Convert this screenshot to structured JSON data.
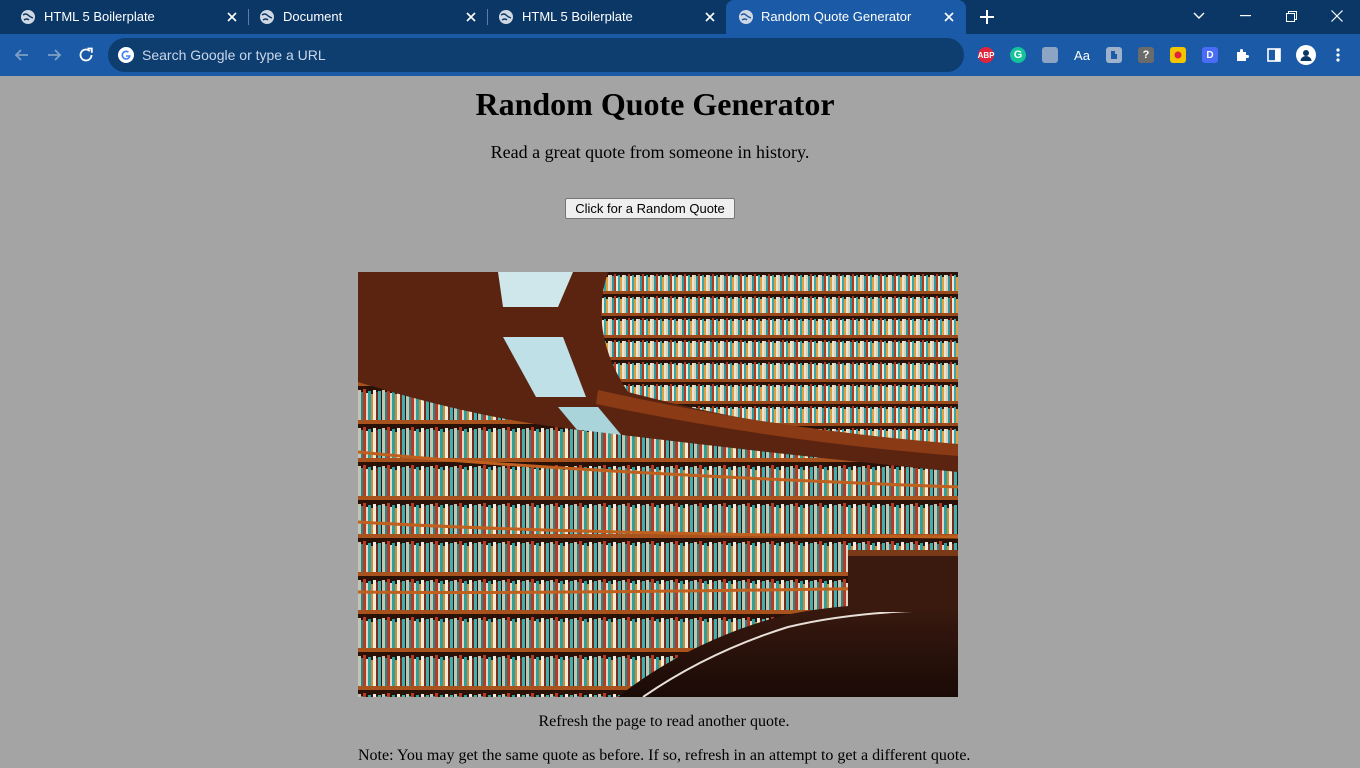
{
  "browser": {
    "tabs": [
      {
        "title": "HTML 5 Boilerplate",
        "active": false
      },
      {
        "title": "Document",
        "active": false
      },
      {
        "title": "HTML 5 Boilerplate",
        "active": false
      },
      {
        "title": "Random Quote Generator",
        "active": true
      }
    ],
    "omnibox": {
      "placeholder": "Search Google or type a URL"
    },
    "extensions": [
      {
        "name": "adblock-plus-icon",
        "label": "ABP",
        "color": "#e0243b"
      },
      {
        "name": "grammarly-icon",
        "label": "G",
        "color": "#15c39a"
      },
      {
        "name": "extension-square-icon",
        "label": "",
        "color": "#8ea4c4"
      },
      {
        "name": "font-aa-icon",
        "label": "Aa",
        "color": ""
      },
      {
        "name": "extension-puzzle-icon",
        "label": "",
        "color": "#9fb2cc"
      },
      {
        "name": "question-icon",
        "label": "?",
        "color": "#6b6b6b"
      },
      {
        "name": "extension-yellow-icon",
        "label": "",
        "color": "#f2c500"
      },
      {
        "name": "d-extension-icon",
        "label": "D",
        "color": "#4a6cf7"
      }
    ],
    "colors": {
      "tabstrip": "#0b3766",
      "toolbar": "#1a5aa6",
      "page_background": "#a4a4a4"
    }
  },
  "page": {
    "title": "Random Quote Generator",
    "subtitle": "Read a great quote from someone in history.",
    "button_label": "Click for a Random Quote",
    "image_subject": "library-bookshelves",
    "refresh_text": "Refresh the page to read another quote.",
    "note_text": "Note: You may get the same quote as before. If so, refresh in an attempt to get a different quote."
  }
}
